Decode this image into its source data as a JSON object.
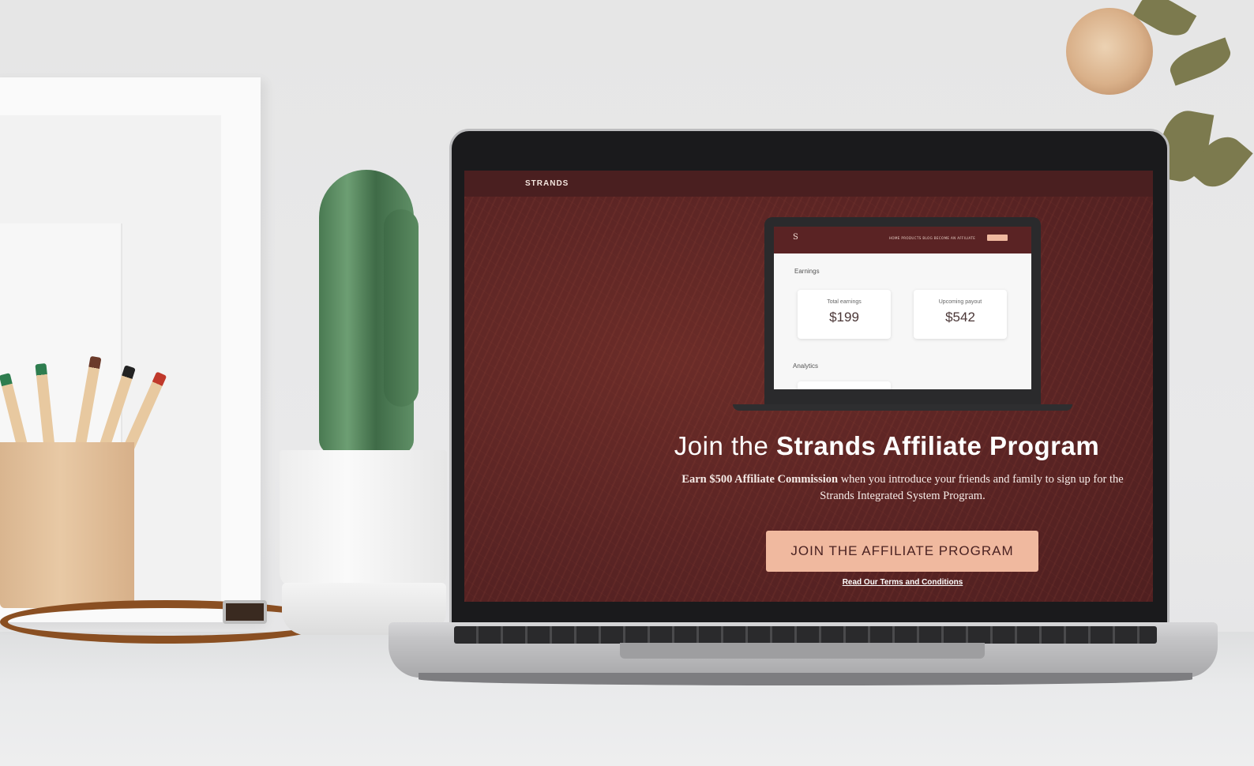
{
  "site": {
    "brand": "STRANDS"
  },
  "mockup": {
    "logo": "S",
    "nav_links": "HOME   PRODUCTS   BLOG   BECOME AN AFFILIATE",
    "earnings_section": "Earnings",
    "analytics_section": "Analytics",
    "cards": [
      {
        "label": "Total earnings",
        "value": "$199"
      },
      {
        "label": "Upcoming payout",
        "value": "$542"
      }
    ]
  },
  "hero": {
    "title_light": "Join the ",
    "title_bold": "Strands Affiliate Program",
    "subtitle_bold": "Earn $500 Affiliate Commission",
    "subtitle_rest": " when you introduce your friends and family to sign up for the Strands Integrated System Program.",
    "cta_label": "JOIN THE AFFILIATE PROGRAM",
    "terms_link": "Read Our Terms and Conditions"
  },
  "colors": {
    "hero_bg": "#5a2424",
    "nav_bg": "#4a1f20",
    "cta_bg": "#f0b99f",
    "cta_text": "#4a2222"
  }
}
